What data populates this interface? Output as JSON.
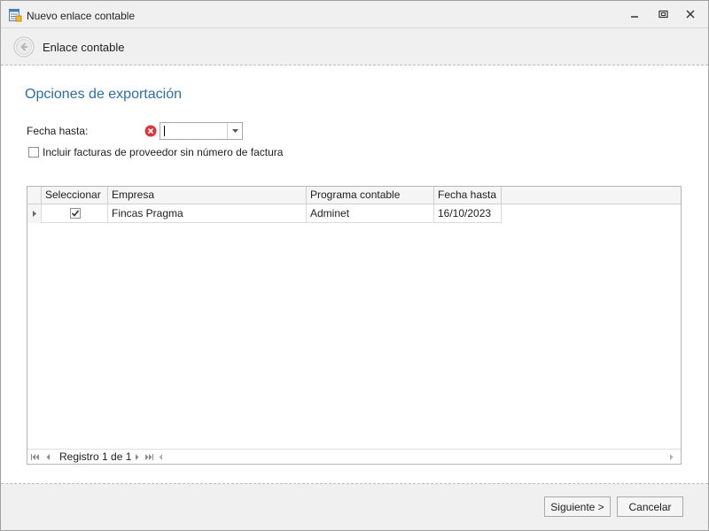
{
  "window": {
    "title": "Nuevo enlace contable",
    "icon": "document-table-icon"
  },
  "header": {
    "title": "Enlace contable",
    "back_icon": "back-arrow-icon"
  },
  "section": {
    "title": "Opciones de exportación"
  },
  "form": {
    "fecha_label": "Fecha hasta:",
    "fecha_value": "",
    "fecha_error": "error-icon",
    "include_label": "Incluir facturas de proveedor sin número de factura",
    "include_checked": false
  },
  "grid": {
    "columns": [
      "Seleccionar",
      "Empresa",
      "Programa contable",
      "Fecha hasta"
    ],
    "rows": [
      {
        "selected": true,
        "empresa": "Fincas Pragma",
        "programa": "Adminet",
        "fecha": "16/10/2023"
      }
    ],
    "navigator": "Registro 1 de 1"
  },
  "footer": {
    "next_label": "Siguiente >",
    "cancel_label": "Cancelar"
  },
  "colors": {
    "accent_title": "#2b6ea8",
    "error": "#d9363e"
  }
}
